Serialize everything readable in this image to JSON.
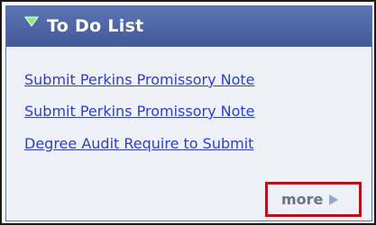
{
  "todo_panel": {
    "title": "To Do List",
    "collapse_icon": "triangle-down-icon",
    "items": [
      {
        "label": "Submit Perkins Promissory Note"
      },
      {
        "label": "Submit Perkins Promissory Note"
      },
      {
        "label": "Degree Audit Require to Submit"
      }
    ],
    "more_label": "more",
    "more_icon": "triangle-right-icon"
  },
  "colors": {
    "header_bg": "#4a62a6",
    "panel_bg": "#eef1f8",
    "link": "#2b3fd0",
    "highlight_border": "#b5121b",
    "collapse_icon": "#7ff07f",
    "more_icon": "#9aa6c8"
  }
}
